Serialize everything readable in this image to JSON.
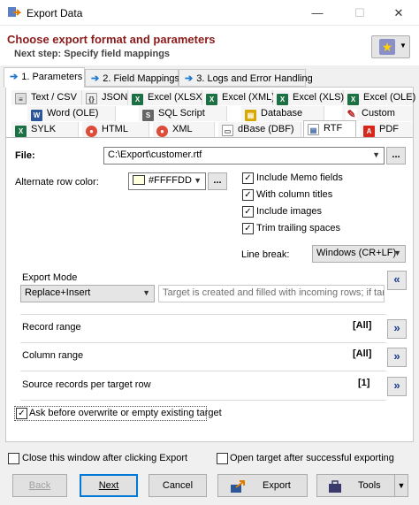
{
  "window": {
    "title": "Export Data",
    "minimize": "—",
    "maximize": "☐",
    "close": "✕"
  },
  "header": {
    "title": "Choose export format and parameters",
    "subtitle": "Next step: Specify field mappings"
  },
  "wizard_tabs": [
    {
      "label": "1. Parameters"
    },
    {
      "label": "2. Field Mappings"
    },
    {
      "label": "3. Logs and Error Handling"
    }
  ],
  "formats": {
    "row1": [
      "Text / CSV",
      "JSON",
      "Excel (XLSX)",
      "Excel (XML)",
      "Excel (XLS)",
      "Excel (OLE)"
    ],
    "row2": [
      "Word (OLE)",
      "SQL Script",
      "Database",
      "Custom"
    ],
    "row3": [
      "SYLK",
      "HTML",
      "XML",
      "dBase (DBF)",
      "RTF",
      "PDF"
    ],
    "selected": "RTF"
  },
  "file": {
    "label": "File:",
    "value": "C:\\Export\\customer.rtf",
    "browse": "..."
  },
  "alt_color": {
    "label": "Alternate row color:",
    "value": "#FFFFDD",
    "swatch": "#FFFFDD",
    "browse": "..."
  },
  "options": [
    {
      "label": "Include Memo fields",
      "checked": "✓"
    },
    {
      "label": "With column titles",
      "checked": "✓"
    },
    {
      "label": "Include images",
      "checked": "✓"
    },
    {
      "label": "Trim trailing spaces",
      "checked": "✓"
    }
  ],
  "line_break": {
    "label": "Line break:",
    "value": "Windows (CR+LF)"
  },
  "export_mode": {
    "label": "Export Mode",
    "value": "Replace+Insert",
    "hint": "Target is created and filled with incoming rows; if target...",
    "collapse": "«"
  },
  "ranges": [
    {
      "label": "Record range",
      "value": "[All]",
      "expand": "»"
    },
    {
      "label": "Column range",
      "value": "[All]",
      "expand": "»"
    },
    {
      "label": "Source records per target row",
      "value": "[1]",
      "expand": "»"
    }
  ],
  "ask_overwrite": {
    "label": "Ask before overwrite or empty existing target",
    "checked": "✓"
  },
  "close_after": {
    "label": "Close this window after clicking Export",
    "checked": ""
  },
  "open_target": {
    "label": "Open target after successful exporting",
    "checked": ""
  },
  "buttons": {
    "back": "Back",
    "next": "Next",
    "cancel": "Cancel",
    "export": "Export",
    "tools": "Tools"
  },
  "colors": {
    "accent": "#0078d7",
    "header_title": "#8b1a1a"
  }
}
